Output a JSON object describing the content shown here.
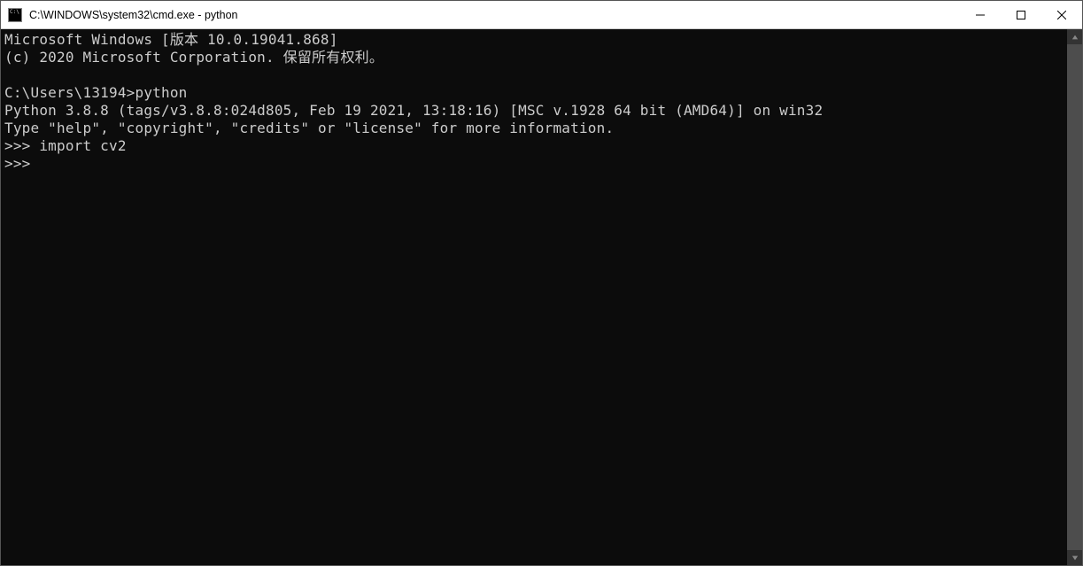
{
  "titlebar": {
    "title": "C:\\WINDOWS\\system32\\cmd.exe - python"
  },
  "terminal": {
    "lines": [
      "Microsoft Windows [版本 10.0.19041.868]",
      "(c) 2020 Microsoft Corporation. 保留所有权利。",
      "",
      "C:\\Users\\13194>python",
      "Python 3.8.8 (tags/v3.8.8:024d805, Feb 19 2021, 13:18:16) [MSC v.1928 64 bit (AMD64)] on win32",
      "Type \"help\", \"copyright\", \"credits\" or \"license\" for more information.",
      ">>> import cv2",
      ">>> "
    ]
  }
}
